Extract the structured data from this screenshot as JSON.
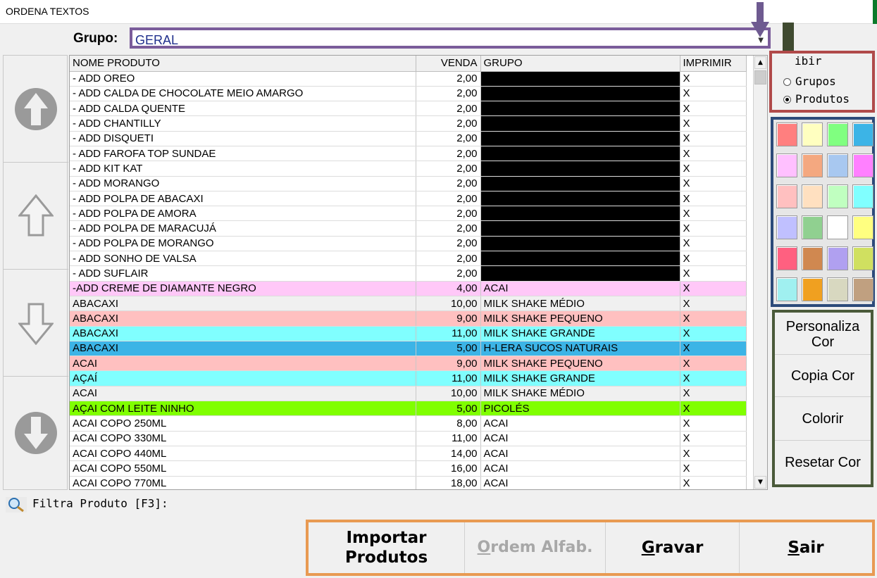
{
  "window": {
    "title": "ORDENA TEXTOS"
  },
  "grupo": {
    "label": "Grupo:",
    "value": "GERAL"
  },
  "table": {
    "columns": [
      "NOME PRODUTO",
      "VENDA",
      "GRUPO",
      "IMPRIMIR"
    ],
    "rows": [
      {
        "name": "-   ADD OREO",
        "venda": "2,00",
        "grupo": "",
        "imprimir": "X",
        "bg": "#ffffff",
        "redacted": true
      },
      {
        "name": "- ADD CALDA DE CHOCOLATE MEIO AMARGO",
        "venda": "2,00",
        "grupo": "",
        "imprimir": "X",
        "bg": "#ffffff",
        "redacted": true
      },
      {
        "name": "- ADD CALDA QUENTE",
        "venda": "2,00",
        "grupo": "",
        "imprimir": "X",
        "bg": "#ffffff",
        "redacted": true
      },
      {
        "name": "- ADD CHANTILLY",
        "venda": "2,00",
        "grupo": "",
        "imprimir": "X",
        "bg": "#ffffff",
        "redacted": true
      },
      {
        "name": "- ADD DISQUETI",
        "venda": "2,00",
        "grupo": "",
        "imprimir": "X",
        "bg": "#ffffff",
        "redacted": true
      },
      {
        "name": "- ADD FAROFA TOP SUNDAE",
        "venda": "2,00",
        "grupo": "",
        "imprimir": "X",
        "bg": "#ffffff",
        "redacted": true
      },
      {
        "name": "- ADD KIT KAT",
        "venda": "2,00",
        "grupo": "",
        "imprimir": "X",
        "bg": "#ffffff",
        "redacted": true
      },
      {
        "name": "- ADD MORANGO",
        "venda": "2,00",
        "grupo": "",
        "imprimir": "X",
        "bg": "#ffffff",
        "redacted": true
      },
      {
        "name": "- ADD POLPA DE ABACAXI",
        "venda": "2,00",
        "grupo": "",
        "imprimir": "X",
        "bg": "#ffffff",
        "redacted": true
      },
      {
        "name": "- ADD POLPA DE AMORA",
        "venda": "2,00",
        "grupo": "",
        "imprimir": "X",
        "bg": "#ffffff",
        "redacted": true
      },
      {
        "name": "- ADD POLPA DE MARACUJÁ",
        "venda": "2,00",
        "grupo": "",
        "imprimir": "X",
        "bg": "#ffffff",
        "redacted": true
      },
      {
        "name": "- ADD POLPA DE MORANGO",
        "venda": "2,00",
        "grupo": "",
        "imprimir": "X",
        "bg": "#ffffff",
        "redacted": true
      },
      {
        "name": "- ADD SONHO DE VALSA",
        "venda": "2,00",
        "grupo": "",
        "imprimir": "X",
        "bg": "#ffffff",
        "redacted": true
      },
      {
        "name": "- ADD SUFLAIR",
        "venda": "2,00",
        "grupo": "",
        "imprimir": "X",
        "bg": "#ffffff",
        "redacted": true
      },
      {
        "name": "-ADD CREME DE DIAMANTE NEGRO",
        "venda": "4,00",
        "grupo": "ACAI",
        "imprimir": "X",
        "bg": "#ffc8f8",
        "redacted": false
      },
      {
        "name": "ABACAXI",
        "venda": "10,00",
        "grupo": "MILK SHAKE MÉDIO",
        "imprimir": "X",
        "bg": "#f0f0f0",
        "redacted": false
      },
      {
        "name": "ABACAXI",
        "venda": "9,00",
        "grupo": "MILK SHAKE PEQUENO",
        "imprimir": "X",
        "bg": "#ffc0c0",
        "redacted": false
      },
      {
        "name": "ABACAXI",
        "venda": "11,00",
        "grupo": "MILK SHAKE GRANDE",
        "imprimir": "X",
        "bg": "#80ffff",
        "redacted": false
      },
      {
        "name": "ABACAXI",
        "venda": "5,00",
        "grupo": "H-LERA SUCOS NATURAIS",
        "imprimir": "X",
        "bg": "#3cb4e6",
        "redacted": false
      },
      {
        "name": "ACAI",
        "venda": "9,00",
        "grupo": "MILK SHAKE PEQUENO",
        "imprimir": "X",
        "bg": "#ffc0c0",
        "redacted": false
      },
      {
        "name": "AÇAÍ",
        "venda": "11,00",
        "grupo": "MILK SHAKE GRANDE",
        "imprimir": "X",
        "bg": "#80ffff",
        "redacted": false
      },
      {
        "name": "ACAI",
        "venda": "10,00",
        "grupo": "MILK SHAKE MÉDIO",
        "imprimir": "X",
        "bg": "#f0f0f0",
        "redacted": false
      },
      {
        "name": "AÇAI COM LEITE NINHO",
        "venda": "5,00",
        "grupo": "PICOLÉS",
        "imprimir": "X",
        "bg": "#80ff00",
        "redacted": false
      },
      {
        "name": "ACAI COPO 250ML",
        "venda": "8,00",
        "grupo": "ACAI",
        "imprimir": "X",
        "bg": "#ffffff",
        "redacted": false
      },
      {
        "name": "ACAI COPO 330ML",
        "venda": "11,00",
        "grupo": "ACAI",
        "imprimir": "X",
        "bg": "#ffffff",
        "redacted": false
      },
      {
        "name": "ACAI COPO 440ML",
        "venda": "14,00",
        "grupo": "ACAI",
        "imprimir": "X",
        "bg": "#ffffff",
        "redacted": false
      },
      {
        "name": "ACAI COPO 550ML",
        "venda": "16,00",
        "grupo": "ACAI",
        "imprimir": "X",
        "bg": "#ffffff",
        "redacted": false
      },
      {
        "name": "ACAI COPO 770ML",
        "venda": "18,00",
        "grupo": "ACAI",
        "imprimir": "X",
        "bg": "#ffffff",
        "redacted": false
      }
    ]
  },
  "exibir": {
    "legend": "ibir",
    "options": [
      {
        "label": "Grupos",
        "checked": false
      },
      {
        "label": "Produtos",
        "checked": true
      }
    ]
  },
  "palette": {
    "colors": [
      "#ff7f7f",
      "#ffffc0",
      "#80ff80",
      "#3cb4e6",
      "#ffc0ff",
      "#f4a880",
      "#a8c8f0",
      "#ff80ff",
      "#ffc0c0",
      "#ffe0c0",
      "#c0ffc0",
      "#80ffff",
      "#c0c0ff",
      "#90d090",
      "#ffffff",
      "#ffff80",
      "#ff6080",
      "#d08850",
      "#b0a0f0",
      "#d0e060",
      "#a0f0f0",
      "#f0a020",
      "#d8d8c0",
      "#c0a080"
    ]
  },
  "color_buttons": [
    {
      "label": "Personaliza Cor"
    },
    {
      "label": "Copia Cor"
    },
    {
      "label": "Colorir"
    },
    {
      "label": "Resetar Cor"
    }
  ],
  "filter": {
    "label": "Filtra Produto [F3]:",
    "icon": "magnifier-icon"
  },
  "bottom_buttons": {
    "importar": "Importar Produtos",
    "ordem": "Ordem Alfab.",
    "gravar": "Gravar",
    "sair": "Sair"
  },
  "colors": {
    "grupo_border": "#7a5c9a",
    "exibir_border": "#b04a4a",
    "palette_border": "#2c4a7a",
    "color_buttons_border": "#4a5a3a",
    "bottom_border": "#e89a52"
  }
}
